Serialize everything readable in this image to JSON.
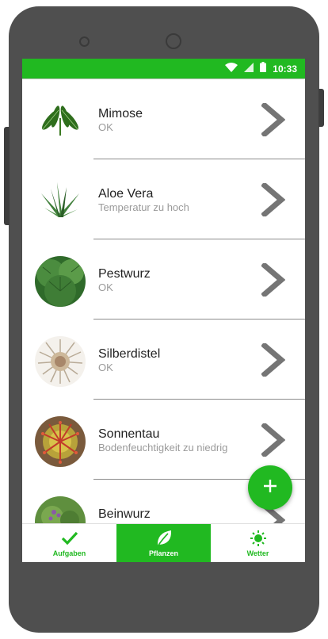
{
  "status_bar": {
    "time": "10:33",
    "icons": [
      "wifi-icon",
      "signal-icon",
      "battery-icon"
    ]
  },
  "plants": [
    {
      "name": "Mimose",
      "status": "OK",
      "image": "mimosa-leaf"
    },
    {
      "name": "Aloe Vera",
      "status": "Temperatur zu hoch",
      "image": "aloe-vera"
    },
    {
      "name": "Pestwurz",
      "status": "OK",
      "image": "butterbur-leaves"
    },
    {
      "name": "Silberdistel",
      "status": "OK",
      "image": "silver-thistle"
    },
    {
      "name": "Sonnentau",
      "status": "Bodenfeuchtigkeit zu niedrig",
      "image": "sundew"
    },
    {
      "name": "Beinwurz",
      "status": "",
      "image": "comfrey"
    }
  ],
  "fab": {
    "icon": "plus-icon"
  },
  "bottom_nav": {
    "items": [
      {
        "label": "Aufgaben",
        "icon": "checkmark-icon",
        "active": false
      },
      {
        "label": "Pflanzen",
        "icon": "leaf-icon",
        "active": true
      },
      {
        "label": "Wetter",
        "icon": "sun-icon",
        "active": false
      }
    ]
  },
  "colors": {
    "accent": "#21b921",
    "chevron": "#757575",
    "secondary_text": "#9a9a9a"
  }
}
